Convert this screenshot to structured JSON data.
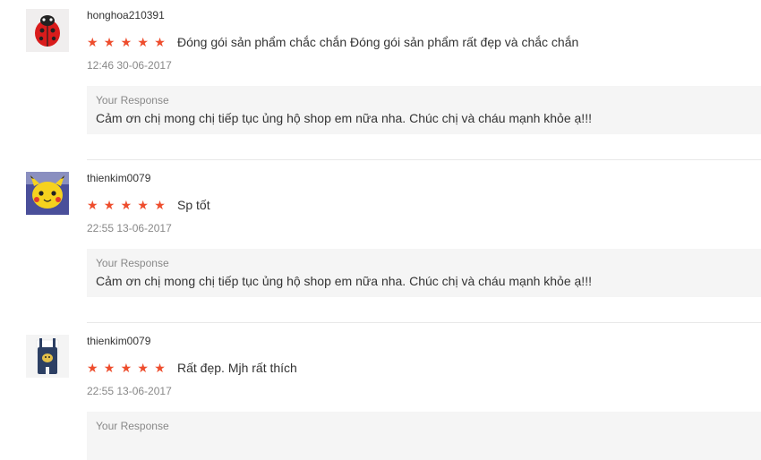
{
  "reviews": [
    {
      "username": "honghoa210391",
      "rating": 5,
      "stars": [
        "★",
        "★",
        "★",
        "★",
        "★"
      ],
      "comment": "Đóng gói sản phẩm chắc chắn Đóng gói sản phẩm rất đẹp và chắc chắn",
      "time": "12:46 30-06-2017",
      "response_title": "Your Response",
      "response_text": "Cảm ơn chị mong chị tiếp tục ủng hộ shop em nữa nha. Chúc chị và cháu mạnh khỏe ạ!!!",
      "avatar_icon": "ladybug-backpack-avatar"
    },
    {
      "username": "thienkim0079",
      "rating": 5,
      "stars": [
        "★",
        "★",
        "★",
        "★",
        "★"
      ],
      "comment": "Sp tốt",
      "time": "22:55 13-06-2017",
      "response_title": "Your Response",
      "response_text": "Cảm ơn chị mong chị tiếp tục ủng hộ shop em nữa nha. Chúc chị và cháu mạnh khỏe ạ!!!",
      "avatar_icon": "pikachu-backpack-avatar"
    },
    {
      "username": "thienkim0079",
      "rating": 5,
      "stars": [
        "★",
        "★",
        "★",
        "★",
        "★"
      ],
      "comment": "Rất đẹp. Mjh rất thích",
      "time": "22:55 13-06-2017",
      "response_title": "Your Response",
      "response_text": "",
      "avatar_icon": "overalls-outfit-avatar"
    }
  ],
  "colors": {
    "star": "#ee4d2d",
    "response_bg": "#f5f5f5",
    "divider": "#e8e8e8"
  }
}
